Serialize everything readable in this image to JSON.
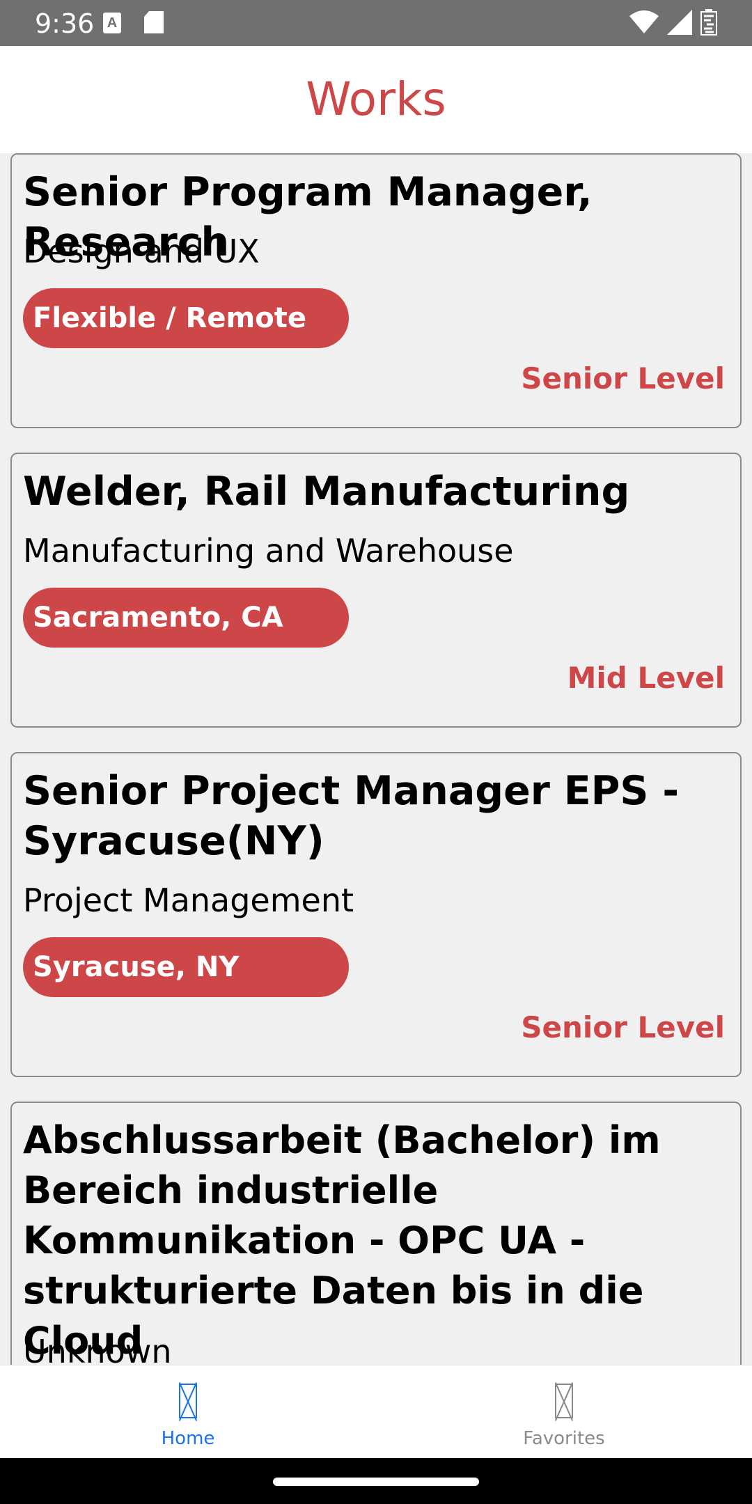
{
  "status_bar": {
    "time": "9:36",
    "icons": [
      "a-notification-icon",
      "sd-card-icon",
      "wifi-icon",
      "cell-signal-icon",
      "battery-icon"
    ]
  },
  "app": {
    "title": "Works",
    "accent_color": "#cd4648"
  },
  "jobs": [
    {
      "title": "Senior Program Manager, Research",
      "department": "Design and UX",
      "location": "Flexible / Remote",
      "level": "Senior Level"
    },
    {
      "title": "Welder, Rail Manufacturing",
      "department": "Manufacturing and Warehouse",
      "location": "Sacramento, CA",
      "level": "Mid Level"
    },
    {
      "title": "Senior Project Manager EPS - Syracuse(NY)",
      "department": "Project Management",
      "location": "Syracuse, NY",
      "level": "Senior Level"
    },
    {
      "title": "Abschlussarbeit (Bachelor) im Bereich industrielle Kommunikation - OPC UA - strukturierte Daten bis in die Cloud",
      "department": "Unknown"
    }
  ],
  "bottom_nav": {
    "items": [
      {
        "label": "Home",
        "icon": "home-icon",
        "active": true,
        "color": "#1a73e8"
      },
      {
        "label": "Favorites",
        "icon": "favorites-icon",
        "active": false,
        "color": "#8a8a8a"
      }
    ]
  }
}
